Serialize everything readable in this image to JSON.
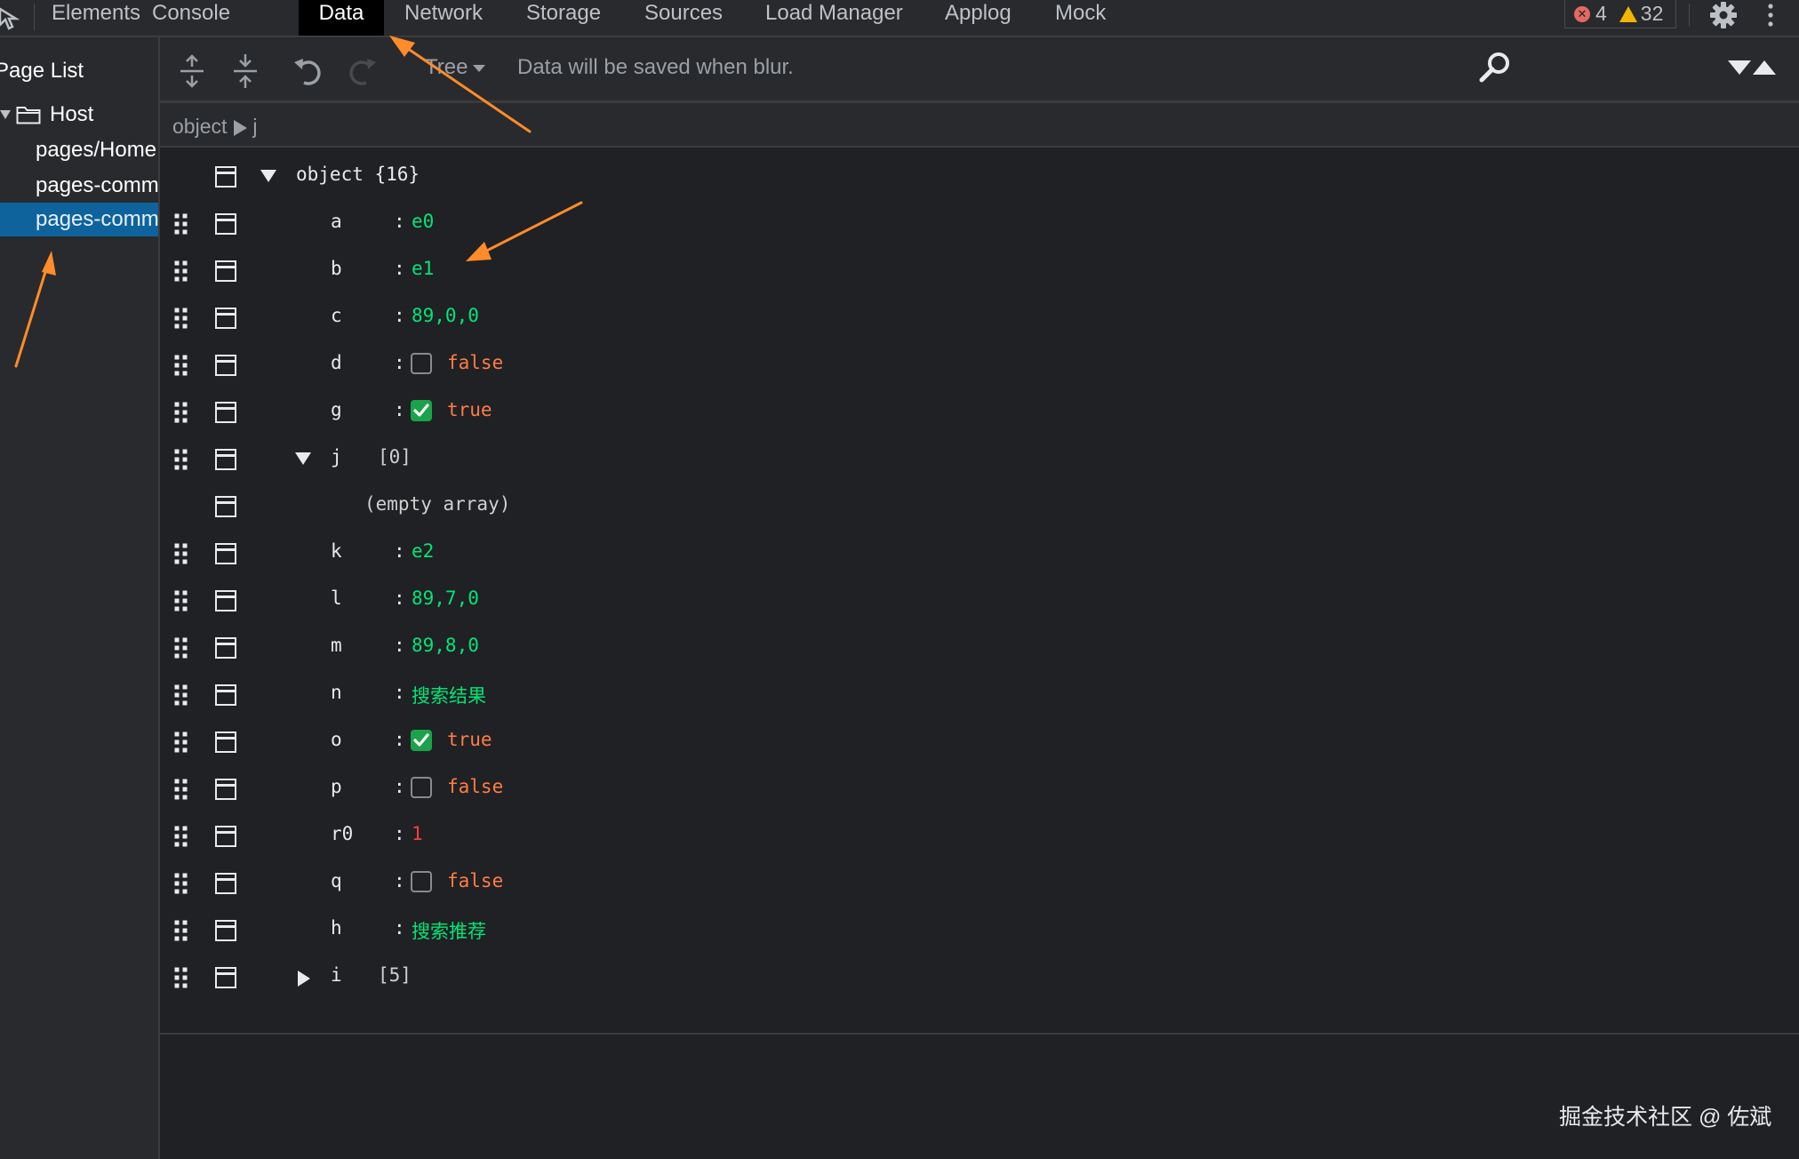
{
  "tabs": [
    {
      "label": "Elements"
    },
    {
      "label": "Console"
    },
    {
      "label": "Data"
    },
    {
      "label": "Network"
    },
    {
      "label": "Storage"
    },
    {
      "label": "Sources"
    },
    {
      "label": "Load Manager"
    },
    {
      "label": "Applog"
    },
    {
      "label": "Mock"
    }
  ],
  "active_tab": "Data",
  "status": {
    "errors": "4",
    "warnings": "32"
  },
  "sidebar": {
    "title": "Page List",
    "host": "Host",
    "pages": [
      "pages/Home",
      "pages-comm",
      "pages-comm"
    ],
    "selected_index": 2
  },
  "toolbar": {
    "mode": "Tree",
    "hint": "Data will be saved when blur."
  },
  "breadcrumb": {
    "root": "object",
    "current": "j"
  },
  "tree": {
    "root_label": "object {16}",
    "rows": [
      {
        "key": "a",
        "value": "e0",
        "type": "string"
      },
      {
        "key": "b",
        "value": "e1",
        "type": "string"
      },
      {
        "key": "c",
        "value": "89,0,0",
        "type": "string"
      },
      {
        "key": "d",
        "value": "false",
        "type": "boolean"
      },
      {
        "key": "g",
        "value": "true",
        "type": "boolean"
      },
      {
        "key": "j",
        "value": "[0]",
        "type": "array",
        "expanded": true
      },
      {
        "key": "",
        "value": "(empty array)",
        "type": "placeholder"
      },
      {
        "key": "k",
        "value": "e2",
        "type": "string"
      },
      {
        "key": "l",
        "value": "89,7,0",
        "type": "string"
      },
      {
        "key": "m",
        "value": "89,8,0",
        "type": "string"
      },
      {
        "key": "n",
        "value": "搜索结果",
        "type": "string"
      },
      {
        "key": "o",
        "value": "true",
        "type": "boolean"
      },
      {
        "key": "p",
        "value": "false",
        "type": "boolean"
      },
      {
        "key": "r0",
        "value": "1",
        "type": "number"
      },
      {
        "key": "q",
        "value": "false",
        "type": "boolean"
      },
      {
        "key": "h",
        "value": "搜索推荐",
        "type": "string"
      },
      {
        "key": "i",
        "value": "[5]",
        "type": "array",
        "expanded": false
      }
    ]
  },
  "watermark": "掘金技术社区 @ 佐斌",
  "colors": {
    "string": "#00e676",
    "boolean": "#ff7d45",
    "number": "#ff3b3b",
    "annotation": "#ff8c2a",
    "selection": "#0e639c"
  }
}
